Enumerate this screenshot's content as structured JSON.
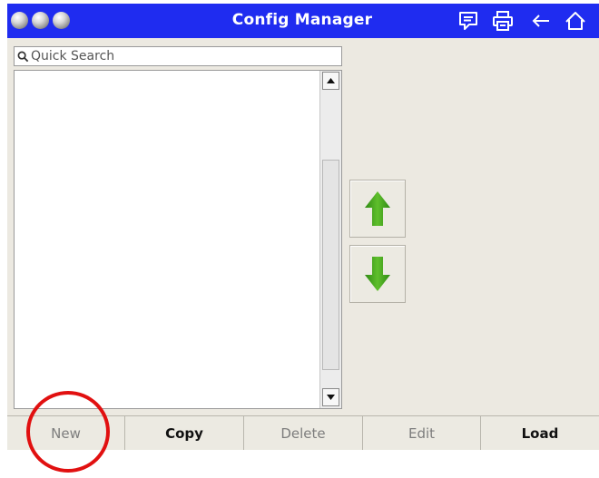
{
  "window": {
    "title": "Config Manager",
    "traffic_lights": [
      "close-dot",
      "minimize-dot",
      "maximize-dot"
    ],
    "toolbar_icons": [
      "chat-icon",
      "printer-icon",
      "back-arrow-icon",
      "home-icon"
    ],
    "title_bar_color": "#1f2cf0"
  },
  "search": {
    "placeholder": "Quick Search",
    "value": "",
    "icon": "search-icon"
  },
  "list": {
    "items": []
  },
  "move_buttons": {
    "up_icon": "green-up-arrow-icon",
    "down_icon": "green-down-arrow-icon",
    "arrow_color": "#3d9a1e"
  },
  "actions": [
    {
      "label": "New",
      "enabled": false
    },
    {
      "label": "Copy",
      "enabled": true
    },
    {
      "label": "Delete",
      "enabled": false
    },
    {
      "label": "Edit",
      "enabled": false
    },
    {
      "label": "Load",
      "enabled": true
    }
  ],
  "annotation": {
    "shape": "circle",
    "color": "#e11010",
    "highlights": "New"
  }
}
